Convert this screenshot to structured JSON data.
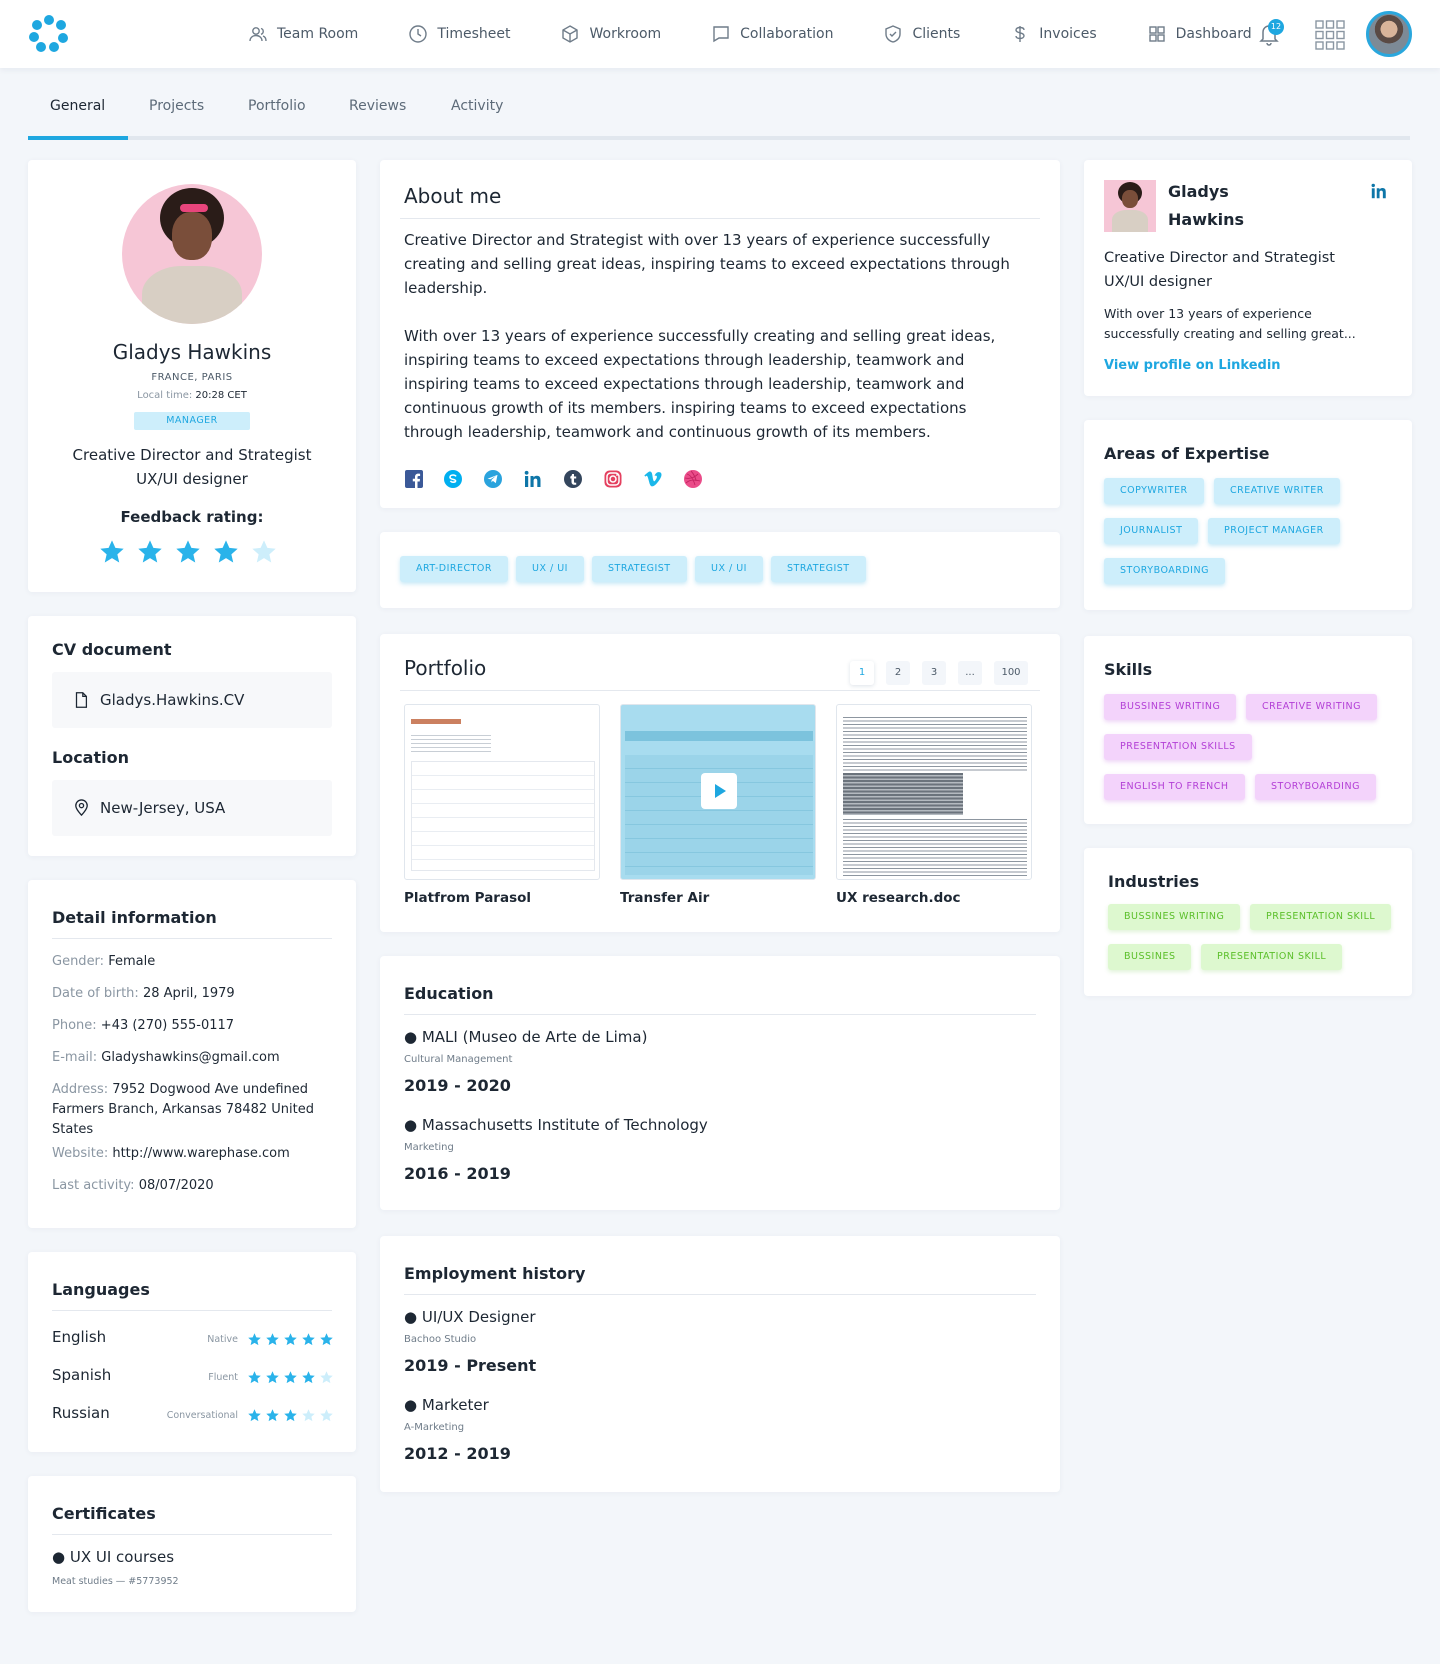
{
  "topbar": {
    "nav": [
      {
        "label": "Team Room",
        "icon": "users-icon"
      },
      {
        "label": "Timesheet",
        "icon": "clock-icon"
      },
      {
        "label": "Workroom",
        "icon": "cube-icon"
      },
      {
        "label": "Collaboration",
        "icon": "chat-icon"
      },
      {
        "label": "Clients",
        "icon": "shield-check-icon"
      },
      {
        "label": "Invoices",
        "icon": "dollar-icon"
      },
      {
        "label": "Dashboard",
        "icon": "dashboard-icon"
      }
    ],
    "notifications_count": "12",
    "accent": "#1ea7e0"
  },
  "tabs": [
    "General",
    "Projects",
    "Portfolio",
    "Reviews",
    "Activity"
  ],
  "profile": {
    "name": "Gladys Hawkins",
    "location": "FRANCE, PARIS",
    "local_time_label": "Local time:",
    "local_time": "20:28 CET",
    "role_badge": "MANAGER",
    "title_line1": "Creative Director and Strategist",
    "title_line2": "UX/UI designer",
    "feedback_label": "Feedback rating:",
    "rating": 4,
    "rating_max": 5
  },
  "cv": {
    "title": "CV document",
    "file": "Gladys.Hawkins.CV",
    "location_title": "Location",
    "location": "New-Jersey, USA"
  },
  "details": {
    "title": "Detail information",
    "gender_label": "Gender:",
    "gender": "Female",
    "dob_label": "Date of birth:",
    "dob": "28 April, 1979",
    "phone_label": "Phone:",
    "phone": "+43 (270) 555-0117",
    "email_label": "E-mail:",
    "email": "Gladyshawkins@gmail.com",
    "address_label": "Address:",
    "address": "7952 Dogwood Ave undefined Farmers Branch, Arkansas 78482 United States",
    "website_label": "Website:",
    "website": "http://www.warephase.com",
    "last_label": "Last activity:",
    "last": "08/07/2020"
  },
  "languages": {
    "title": "Languages",
    "items": [
      {
        "name": "English",
        "level": "Native",
        "stars": 5
      },
      {
        "name": "Spanish",
        "level": "Fluent",
        "stars": 4
      },
      {
        "name": "Russian",
        "level": "Conversational",
        "stars": 3
      }
    ]
  },
  "certificates": {
    "title": "Certificates",
    "item": "● UX UI courses",
    "sub": "Meat studies — #5773952"
  },
  "about": {
    "title": "About me",
    "p1": "Creative Director and Strategist with over 13 years of experience successfully creating and selling great ideas, inspiring teams to exceed expectations through leadership.",
    "p2": "With over 13 years of experience successfully creating and selling great ideas, inspiring teams to exceed expectations through leadership, teamwork and inspiring teams to exceed expectations through leadership, teamwork and continuous growth of its members. inspiring teams to exceed expectations through leadership, teamwork and continuous growth of its members.",
    "socials": [
      "facebook-icon",
      "skype-icon",
      "telegram-icon",
      "linkedin-icon",
      "tumblr-icon",
      "instagram-icon",
      "vimeo-icon",
      "dribbble-icon"
    ]
  },
  "tags": [
    "ART-DIRECTOR",
    "UX / UI",
    "STRATEGIST",
    "UX / UI",
    "STRATEGIST"
  ],
  "portfolio": {
    "title": "Portfolio",
    "pages": [
      "1",
      "2",
      "3",
      "...",
      "100"
    ],
    "items": [
      "Platfrom Parasol",
      "Transfer Air",
      "UX research.doc"
    ]
  },
  "education": {
    "title": "Education",
    "items": [
      {
        "name": "● MALI (Museo de Arte de Lima)",
        "sub": "Cultural Management",
        "years": "2019 - 2020"
      },
      {
        "name": "● Massachusetts Institute of Technology",
        "sub": "Marketing",
        "years": "2016 - 2019"
      }
    ]
  },
  "employment": {
    "title": "Employment history",
    "items": [
      {
        "name": "● UI/UX Designer",
        "sub": "Bachoo Studio",
        "years": "2019 - Present"
      },
      {
        "name": "● Marketer",
        "sub": "A-Marketing",
        "years": "2012 - 2019"
      }
    ]
  },
  "linkedin_card": {
    "first": "Gladys",
    "last": "Hawkins",
    "title1": "Creative Director and Strategist",
    "title2": "UX/UI designer",
    "desc1": "With over 13 years of experience",
    "desc2": "successfully creating and selling great...",
    "link": "View profile on Linkedin"
  },
  "expertise": {
    "title": "Areas of Expertise",
    "chips": [
      "COPYWRITER",
      "CREATIVE WRITER",
      "JOURNALIST",
      "PROJECT MANAGER",
      "STORYBOARDING"
    ]
  },
  "skills": {
    "title": "Skills",
    "chips": [
      "BUSSINES WRITING",
      "CREATIVE WRITING",
      "PRESENTATION SKILLS",
      "ENGLISH TO FRENCH",
      "STORYBOARDING"
    ]
  },
  "industries": {
    "title": "Industries",
    "chips": [
      "BUSSINES WRITING",
      "PRESENTATION SKILL",
      "BUSSINES",
      "PRESENTATION SKILL"
    ]
  }
}
